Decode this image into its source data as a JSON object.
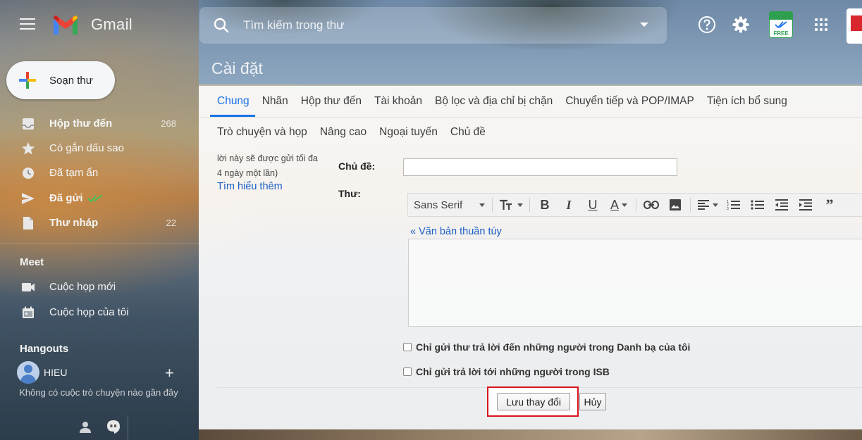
{
  "app": {
    "name": "Gmail"
  },
  "search": {
    "placeholder": "Tìm kiếm trong thư"
  },
  "header_badges": {
    "free": "FREE"
  },
  "compose": {
    "label": "Soạn thư"
  },
  "sidebar": {
    "items": [
      {
        "label": "Hộp thư đến",
        "count": "268",
        "icon": "inbox-icon",
        "bold": true
      },
      {
        "label": "Có gắn dấu sao",
        "count": "",
        "icon": "star-icon",
        "bold": false
      },
      {
        "label": "Đã tạm ẩn",
        "count": "",
        "icon": "clock-icon",
        "bold": false
      },
      {
        "label": "Đã gửi",
        "count": "",
        "icon": "send-icon",
        "bold": true
      },
      {
        "label": "Thư nháp",
        "count": "22",
        "icon": "draft-icon",
        "bold": true
      }
    ],
    "meet": {
      "title": "Meet",
      "items": [
        {
          "label": "Cuộc họp mới",
          "icon": "video-icon"
        },
        {
          "label": "Cuộc họp của tôi",
          "icon": "calendar-icon"
        }
      ]
    },
    "hangouts": {
      "title": "Hangouts",
      "user": "HIEU",
      "empty_text": "Không có cuộc trò chuyện nào gần đây"
    }
  },
  "settings": {
    "title": "Cài đặt",
    "tabs_row1": [
      "Chung",
      "Nhãn",
      "Hộp thư đến",
      "Tài khoản",
      "Bộ lọc và địa chỉ bị chặn",
      "Chuyển tiếp và POP/IMAP",
      "Tiện ích bổ sung"
    ],
    "tabs_row2": [
      "Trò chuyện và họp",
      "Nâng cao",
      "Ngoại tuyến",
      "Chủ đề"
    ],
    "active_tab": "Chung",
    "note_line1": "lời này sẽ được gửi tối đa",
    "note_line2": "4 ngày một lần)",
    "learn_more": "Tìm hiểu thêm",
    "subject_label": "Chủ đề:",
    "subject_value": "",
    "message_label": "Thư:",
    "font_name": "Sans Serif",
    "plain_text_link": "« Văn bản thuần túy",
    "checkbox1": "Chỉ gửi thư trả lời đến những người trong Danh bạ của tôi",
    "checkbox2": "Chỉ gửi trả lời tới những người trong ISB",
    "save_button": "Lưu thay đổi",
    "cancel_button": "Hủy"
  },
  "colors": {
    "accent": "#1a73e8",
    "highlight": "#d7141a",
    "link": "#1a5fc4"
  }
}
